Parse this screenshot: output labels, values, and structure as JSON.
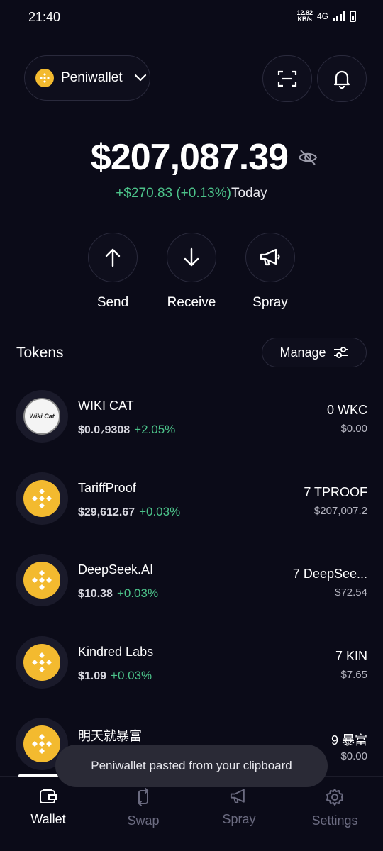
{
  "status_bar": {
    "time": "21:40",
    "net_speed_value": "12.82",
    "net_speed_unit": "KB/s",
    "network": "4G"
  },
  "header": {
    "wallet_name": "Peniwallet",
    "wallet_icon": "bnb-coin-icon",
    "scan_icon": "scan-icon",
    "bell_icon": "bell-icon"
  },
  "balance": {
    "amount": "$207,087.39",
    "change_value": "+$270.83 (+0.13%)",
    "change_label": "Today"
  },
  "actions": [
    {
      "label": "Send",
      "icon": "arrow-up-icon"
    },
    {
      "label": "Receive",
      "icon": "arrow-down-icon"
    },
    {
      "label": "Spray",
      "icon": "megaphone-icon"
    }
  ],
  "tokens_section": {
    "title": "Tokens",
    "manage_label": "Manage"
  },
  "tokens": [
    {
      "name": "WIKI CAT",
      "price": "$0.0₇9308",
      "change": "+2.05%",
      "amount": "0 WKC",
      "value": "$0.00",
      "icon_text": "Wiki Cat"
    },
    {
      "name": "TariffProof",
      "price": "$29,612.67",
      "change": "+0.03%",
      "amount": "7 TPROOF",
      "value": "$207,007.2"
    },
    {
      "name": "DeepSeek.AI",
      "price": "$10.38",
      "change": "+0.03%",
      "amount": "7 DeepSee...",
      "value": "$72.54"
    },
    {
      "name": "Kindred Labs",
      "price": "$1.09",
      "change": "+0.03%",
      "amount": "7 KIN",
      "value": "$7.65"
    },
    {
      "name": "明天就暴富",
      "price": "",
      "change": "",
      "amount": "9 暴富",
      "value": "$0.00"
    }
  ],
  "toast": {
    "message": "Peniwallet pasted from your clipboard"
  },
  "nav": [
    {
      "label": "Wallet",
      "icon": "wallet-icon",
      "active": true
    },
    {
      "label": "Swap",
      "icon": "swap-icon",
      "active": false
    },
    {
      "label": "Spray",
      "icon": "megaphone-icon",
      "active": false
    },
    {
      "label": "Settings",
      "icon": "gear-icon",
      "active": false
    }
  ],
  "colors": {
    "background": "#0b0b18",
    "positive": "#4cc38a",
    "bnb_yellow": "#f3ba2f"
  }
}
